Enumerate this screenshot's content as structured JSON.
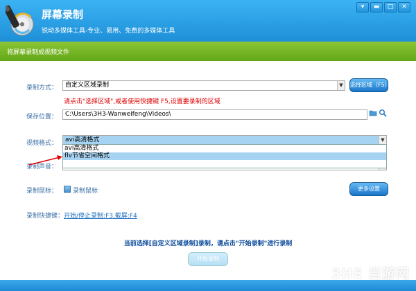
{
  "app": {
    "title": "屏幕录制",
    "subtitle": "锐动多媒体工具-专业、易用、免费的多媒体工具"
  },
  "window_controls": {
    "menu": "▾",
    "minimize": "▬",
    "maximize": "□",
    "close": "✕"
  },
  "section": {
    "header": "将屏幕录制成视频文件"
  },
  "record_mode": {
    "label": "录制方式：",
    "value": "自定义区域录制",
    "button": "选择区域（F5）",
    "hint": "请点击\"选择区域\",或者使用快捷键 F5,设置要录制的区域"
  },
  "save_location": {
    "label": "保存位置：",
    "value": "C:\\Users\\3H3-Wanweifeng\\Videos\\"
  },
  "video_format": {
    "label": "视频格式：",
    "value": "avi高清格式",
    "options": [
      "avi高清格式",
      "flv节省空间格式"
    ],
    "highlighted_index": 1
  },
  "audio": {
    "label": "录制声音："
  },
  "mouse": {
    "label": "录制鼠标：",
    "checkbox_label": "录制鼠标",
    "checked": true,
    "more_settings": "更多设置"
  },
  "shortcuts": {
    "label": "录制快捷键：",
    "value": "开始/停止录制:F3,截屏:F4"
  },
  "status": {
    "message": "当前选择[自定义区域录制]录制，请点击\"开始录制\"进行录制"
  },
  "start_button": "开始录制",
  "watermark": "3HE 当游网",
  "colors": {
    "title_blue": "#1e8fd8",
    "green_bar": "#63a718",
    "hint_red": "#e00000",
    "dropdown_highlight": "#a7d3f2"
  }
}
